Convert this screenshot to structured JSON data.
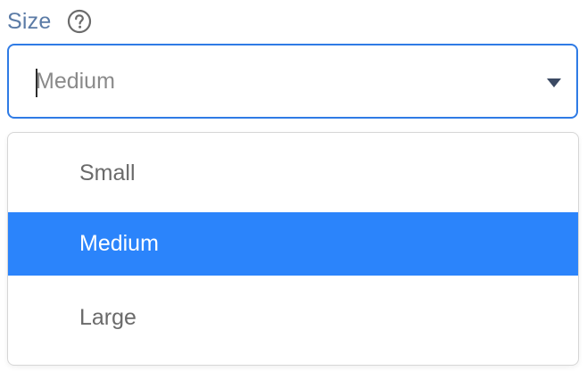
{
  "field": {
    "label": "Size",
    "help_icon": "question-circle-icon"
  },
  "select": {
    "value": "Medium",
    "arrow_icon": "caret-down-icon",
    "border_color": "#2f7be5"
  },
  "menu": {
    "options": [
      {
        "label": "Small",
        "selected": false
      },
      {
        "label": "Medium",
        "selected": true
      },
      {
        "label": "Large",
        "selected": false
      }
    ],
    "selected_bg": "#2b84fb"
  }
}
